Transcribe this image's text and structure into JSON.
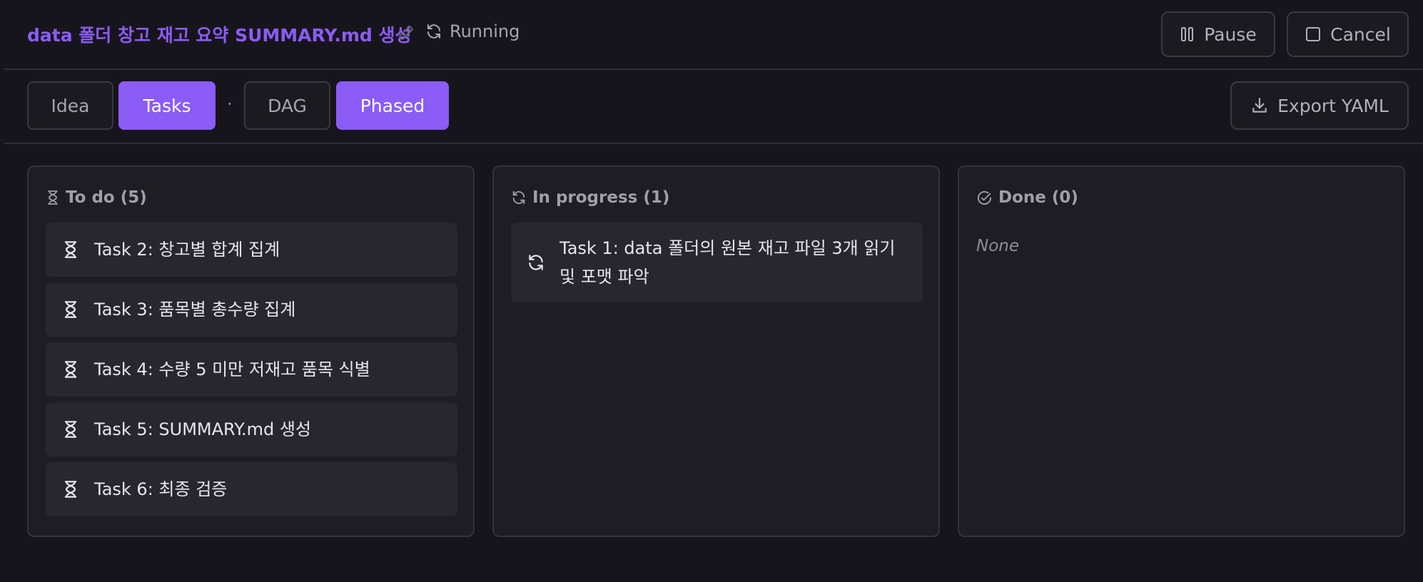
{
  "header": {
    "title": "data 폴더 창고 재고 요약 SUMMARY.md 생성",
    "status": "Running",
    "pause_label": "Pause",
    "cancel_label": "Cancel"
  },
  "tabs": {
    "items": [
      {
        "label": "Idea",
        "active": false
      },
      {
        "label": "Tasks",
        "active": true
      },
      {
        "label": "DAG",
        "active": false
      },
      {
        "label": "Phased",
        "active": true
      }
    ],
    "separator": "·",
    "export_label": "Export YAML"
  },
  "board": {
    "columns": [
      {
        "title": "To do (5)",
        "icon": "hourglass-icon",
        "cards": [
          {
            "text": "Task 2: 창고별 합계 집계",
            "icon": "hourglass-icon"
          },
          {
            "text": "Task 3: 품목별 총수량 집계",
            "icon": "hourglass-icon"
          },
          {
            "text": "Task 4: 수량 5 미만 저재고 품목 식별",
            "icon": "hourglass-icon"
          },
          {
            "text": "Task 5: SUMMARY.md 생성",
            "icon": "hourglass-icon"
          },
          {
            "text": "Task 6: 최종 검증",
            "icon": "hourglass-icon"
          }
        ]
      },
      {
        "title": "In progress (1)",
        "icon": "refresh-icon",
        "cards": [
          {
            "text": "Task 1: data 폴더의 원본 재고 파일 3개 읽기 및 포맷 파악",
            "icon": "refresh-icon"
          }
        ]
      },
      {
        "title": "Done (0)",
        "icon": "check-circle-icon",
        "cards": [],
        "empty_text": "None"
      }
    ]
  },
  "colors": {
    "accent": "#8b5cf6",
    "background": "#17151c",
    "panel": "#1e1d23",
    "card": "#28262e"
  }
}
